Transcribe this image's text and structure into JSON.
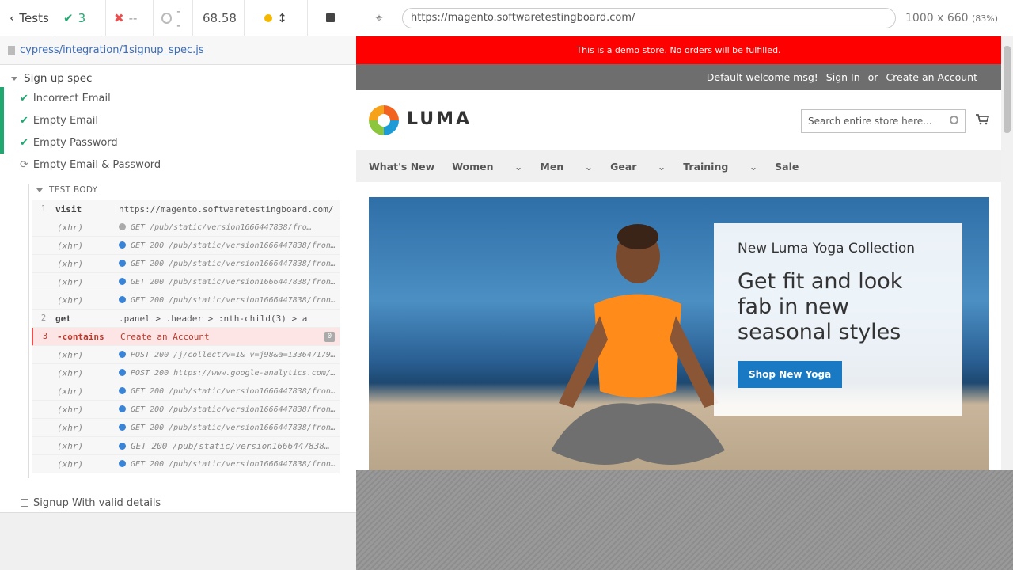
{
  "runner": {
    "tests_label": "Tests",
    "passed": "3",
    "failed": "--",
    "pending": "--",
    "duration": "68.58",
    "spec_file": "cypress/integration/1signup_spec.js"
  },
  "reporter": {
    "suite_title": "Sign up spec",
    "tests": [
      {
        "title": "Incorrect Email"
      },
      {
        "title": "Empty Email"
      },
      {
        "title": "Empty Password"
      },
      {
        "title": "Empty Email & Password"
      }
    ],
    "test_body_label": "TEST BODY",
    "commands": [
      {
        "num": "1",
        "name": "visit",
        "msg": "https://magento.softwaretestingboard.com/"
      },
      {
        "xhr": "(xhr)",
        "msg": "GET /pub/static/version1666447838/fro…"
      },
      {
        "xhr": "(xhr)",
        "msg": "GET 200 /pub/static/version1666447838/fronte…"
      },
      {
        "xhr": "(xhr)",
        "msg": "GET 200 /pub/static/version1666447838/fronte…"
      },
      {
        "xhr": "(xhr)",
        "msg": "GET 200 /pub/static/version1666447838/fronte…"
      },
      {
        "xhr": "(xhr)",
        "msg": "GET 200 /pub/static/version1666447838/fronte…"
      },
      {
        "num": "2",
        "name": "get",
        "msg": ".panel > .header > :nth-child(3) > a"
      },
      {
        "num": "3",
        "name": "-contains",
        "msg": "Create an Account",
        "badge": "0"
      },
      {
        "xhr": "(xhr)",
        "msg": "POST 200 /j/collect?v=1&_v=j98&a=1336471793&…"
      },
      {
        "xhr": "(xhr)",
        "msg": "POST 200 https://www.google-analytics.com/j/…"
      },
      {
        "xhr": "(xhr)",
        "msg": "GET 200 /pub/static/version1666447838/fronte…"
      },
      {
        "xhr": "(xhr)",
        "msg": "GET 200 /pub/static/version1666447838/fronte…"
      },
      {
        "xhr": "(xhr)",
        "msg": "GET 200 /pub/static/version1666447838/fronte…"
      },
      {
        "xhr": "(xhr)",
        "msg": "GET 200 /pub/static/version1666447838…"
      },
      {
        "xhr": "(xhr)",
        "msg": "GET 200 /pub/static/version1666447838/fronte…"
      }
    ],
    "pending_test": "Signup With valid details"
  },
  "browser": {
    "url": "https://magento.softwaretestingboard.com/",
    "viewport": "1000 x 660",
    "scale": "(83%)"
  },
  "site": {
    "demo_notice": "This is a demo store. No orders will be fulfilled.",
    "welcome": "Default welcome msg!",
    "sign_in": "Sign In",
    "or": "or",
    "create_account": "Create an Account",
    "logo_text": "LUMA",
    "search_placeholder": "Search entire store here...",
    "nav": [
      "What's New",
      "Women",
      "Men",
      "Gear",
      "Training",
      "Sale"
    ],
    "hero_title": "New Luma Yoga Collection",
    "hero_subtitle": "Get fit and look fab in new seasonal styles",
    "hero_button": "Shop New Yoga"
  }
}
